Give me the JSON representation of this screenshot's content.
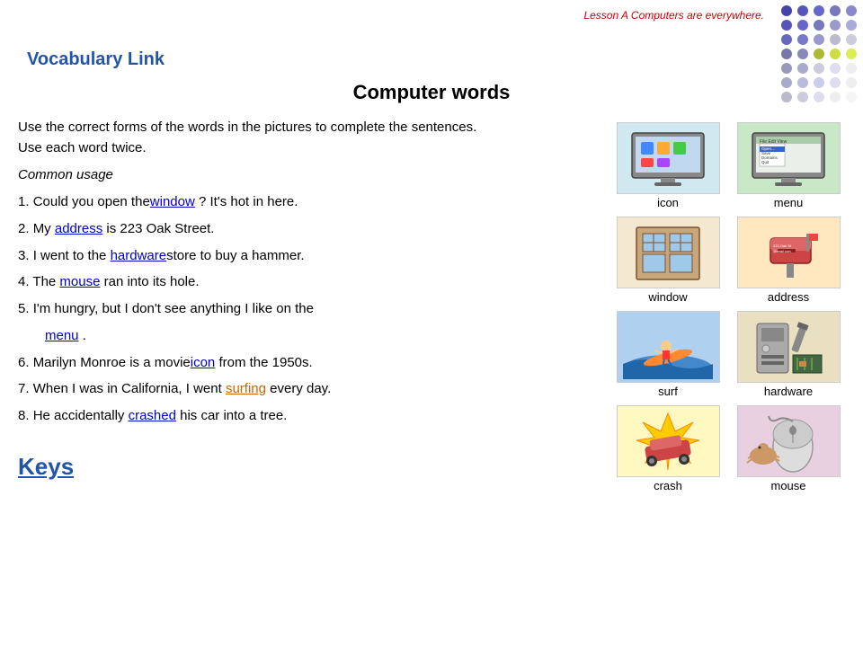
{
  "lesson_label": "Lesson A  Computers are everywhere.",
  "vocab_link": "Vocabulary Link",
  "main_title": "Computer words",
  "instructions_line1": "Use the correct forms of the words in the pictures to complete the sentences.",
  "instructions_line2": "Use each word twice.",
  "common_usage": "Common usage",
  "sentences": [
    {
      "num": "1.",
      "before": "Could you open the",
      "answer": "window",
      "after": " ? It’s hot in here.",
      "answer_style": "blue"
    },
    {
      "num": "2.",
      "before": "My ",
      "answer": "address",
      "after": " is 223 Oak Street.",
      "answer_style": "blue"
    },
    {
      "num": "3.",
      "before": "I went to the ",
      "answer": "hardware",
      "after": "store to buy a hammer.",
      "answer_style": "blue"
    },
    {
      "num": "4.",
      "before": "The ",
      "answer": "mouse",
      "after": " ran into its hole.",
      "answer_style": "blue"
    },
    {
      "num": "5.",
      "before": "I’m hungry, but I don’t see anything I like on the",
      "answer": "",
      "after": "",
      "answer_style": "blue",
      "continuation": true
    },
    {
      "num": "",
      "before": "    ",
      "answer": "menu",
      "after": " .",
      "answer_style": "blue",
      "indent": true
    },
    {
      "num": "6.",
      "before": "Marilyn Monroe is a movie",
      "answer": "icon",
      "after": " from the 1950s.",
      "answer_style": "blue"
    },
    {
      "num": "7.",
      "before": "When I was in California, I went ",
      "answer": "surfing",
      "after": " every day.",
      "answer_style": "orange"
    },
    {
      "num": "8.",
      "before": "He accidentally ",
      "answer": "crashed",
      "after": " his car into a tree.",
      "answer_style": "blue"
    }
  ],
  "keys_label": "Keys",
  "images": [
    {
      "name": "icon",
      "label": "icon",
      "color": "#d0e8f0"
    },
    {
      "name": "menu",
      "label": "menu",
      "color": "#c8e8c8"
    },
    {
      "name": "window",
      "label": "window",
      "color": "#e8d8c0"
    },
    {
      "name": "address",
      "label": "address",
      "color": "#ffd8b0"
    },
    {
      "name": "surf",
      "label": "surf",
      "color": "#c0d8f8"
    },
    {
      "name": "hardware",
      "label": "hardware",
      "color": "#e8e0c8"
    },
    {
      "name": "crash",
      "label": "crash",
      "color": "#f8e0a0"
    },
    {
      "name": "mouse",
      "label": "mouse",
      "color": "#e8d0e8"
    }
  ],
  "dots": {
    "colors": [
      "#5555aa",
      "#7777bb",
      "#9999cc",
      "#bbbbcc",
      "#ccccdd",
      "#aabb33",
      "#ccdd44",
      "#ddee55"
    ]
  }
}
